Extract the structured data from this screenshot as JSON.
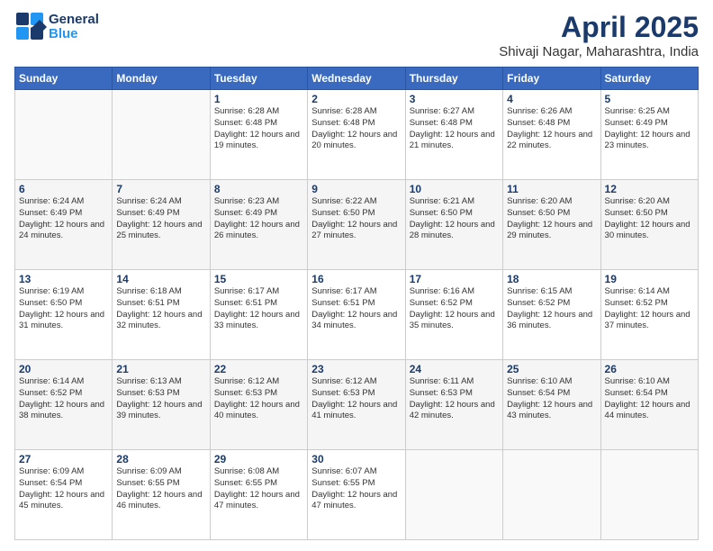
{
  "logo": {
    "line1": "General",
    "line2": "Blue"
  },
  "title": "April 2025",
  "subtitle": "Shivaji Nagar, Maharashtra, India",
  "days": [
    "Sunday",
    "Monday",
    "Tuesday",
    "Wednesday",
    "Thursday",
    "Friday",
    "Saturday"
  ],
  "weeks": [
    [
      {
        "day": "",
        "sunrise": "",
        "sunset": "",
        "daylight": ""
      },
      {
        "day": "",
        "sunrise": "",
        "sunset": "",
        "daylight": ""
      },
      {
        "day": "1",
        "sunrise": "Sunrise: 6:28 AM",
        "sunset": "Sunset: 6:48 PM",
        "daylight": "Daylight: 12 hours and 19 minutes."
      },
      {
        "day": "2",
        "sunrise": "Sunrise: 6:28 AM",
        "sunset": "Sunset: 6:48 PM",
        "daylight": "Daylight: 12 hours and 20 minutes."
      },
      {
        "day": "3",
        "sunrise": "Sunrise: 6:27 AM",
        "sunset": "Sunset: 6:48 PM",
        "daylight": "Daylight: 12 hours and 21 minutes."
      },
      {
        "day": "4",
        "sunrise": "Sunrise: 6:26 AM",
        "sunset": "Sunset: 6:48 PM",
        "daylight": "Daylight: 12 hours and 22 minutes."
      },
      {
        "day": "5",
        "sunrise": "Sunrise: 6:25 AM",
        "sunset": "Sunset: 6:49 PM",
        "daylight": "Daylight: 12 hours and 23 minutes."
      }
    ],
    [
      {
        "day": "6",
        "sunrise": "Sunrise: 6:24 AM",
        "sunset": "Sunset: 6:49 PM",
        "daylight": "Daylight: 12 hours and 24 minutes."
      },
      {
        "day": "7",
        "sunrise": "Sunrise: 6:24 AM",
        "sunset": "Sunset: 6:49 PM",
        "daylight": "Daylight: 12 hours and 25 minutes."
      },
      {
        "day": "8",
        "sunrise": "Sunrise: 6:23 AM",
        "sunset": "Sunset: 6:49 PM",
        "daylight": "Daylight: 12 hours and 26 minutes."
      },
      {
        "day": "9",
        "sunrise": "Sunrise: 6:22 AM",
        "sunset": "Sunset: 6:50 PM",
        "daylight": "Daylight: 12 hours and 27 minutes."
      },
      {
        "day": "10",
        "sunrise": "Sunrise: 6:21 AM",
        "sunset": "Sunset: 6:50 PM",
        "daylight": "Daylight: 12 hours and 28 minutes."
      },
      {
        "day": "11",
        "sunrise": "Sunrise: 6:20 AM",
        "sunset": "Sunset: 6:50 PM",
        "daylight": "Daylight: 12 hours and 29 minutes."
      },
      {
        "day": "12",
        "sunrise": "Sunrise: 6:20 AM",
        "sunset": "Sunset: 6:50 PM",
        "daylight": "Daylight: 12 hours and 30 minutes."
      }
    ],
    [
      {
        "day": "13",
        "sunrise": "Sunrise: 6:19 AM",
        "sunset": "Sunset: 6:50 PM",
        "daylight": "Daylight: 12 hours and 31 minutes."
      },
      {
        "day": "14",
        "sunrise": "Sunrise: 6:18 AM",
        "sunset": "Sunset: 6:51 PM",
        "daylight": "Daylight: 12 hours and 32 minutes."
      },
      {
        "day": "15",
        "sunrise": "Sunrise: 6:17 AM",
        "sunset": "Sunset: 6:51 PM",
        "daylight": "Daylight: 12 hours and 33 minutes."
      },
      {
        "day": "16",
        "sunrise": "Sunrise: 6:17 AM",
        "sunset": "Sunset: 6:51 PM",
        "daylight": "Daylight: 12 hours and 34 minutes."
      },
      {
        "day": "17",
        "sunrise": "Sunrise: 6:16 AM",
        "sunset": "Sunset: 6:52 PM",
        "daylight": "Daylight: 12 hours and 35 minutes."
      },
      {
        "day": "18",
        "sunrise": "Sunrise: 6:15 AM",
        "sunset": "Sunset: 6:52 PM",
        "daylight": "Daylight: 12 hours and 36 minutes."
      },
      {
        "day": "19",
        "sunrise": "Sunrise: 6:14 AM",
        "sunset": "Sunset: 6:52 PM",
        "daylight": "Daylight: 12 hours and 37 minutes."
      }
    ],
    [
      {
        "day": "20",
        "sunrise": "Sunrise: 6:14 AM",
        "sunset": "Sunset: 6:52 PM",
        "daylight": "Daylight: 12 hours and 38 minutes."
      },
      {
        "day": "21",
        "sunrise": "Sunrise: 6:13 AM",
        "sunset": "Sunset: 6:53 PM",
        "daylight": "Daylight: 12 hours and 39 minutes."
      },
      {
        "day": "22",
        "sunrise": "Sunrise: 6:12 AM",
        "sunset": "Sunset: 6:53 PM",
        "daylight": "Daylight: 12 hours and 40 minutes."
      },
      {
        "day": "23",
        "sunrise": "Sunrise: 6:12 AM",
        "sunset": "Sunset: 6:53 PM",
        "daylight": "Daylight: 12 hours and 41 minutes."
      },
      {
        "day": "24",
        "sunrise": "Sunrise: 6:11 AM",
        "sunset": "Sunset: 6:53 PM",
        "daylight": "Daylight: 12 hours and 42 minutes."
      },
      {
        "day": "25",
        "sunrise": "Sunrise: 6:10 AM",
        "sunset": "Sunset: 6:54 PM",
        "daylight": "Daylight: 12 hours and 43 minutes."
      },
      {
        "day": "26",
        "sunrise": "Sunrise: 6:10 AM",
        "sunset": "Sunset: 6:54 PM",
        "daylight": "Daylight: 12 hours and 44 minutes."
      }
    ],
    [
      {
        "day": "27",
        "sunrise": "Sunrise: 6:09 AM",
        "sunset": "Sunset: 6:54 PM",
        "daylight": "Daylight: 12 hours and 45 minutes."
      },
      {
        "day": "28",
        "sunrise": "Sunrise: 6:09 AM",
        "sunset": "Sunset: 6:55 PM",
        "daylight": "Daylight: 12 hours and 46 minutes."
      },
      {
        "day": "29",
        "sunrise": "Sunrise: 6:08 AM",
        "sunset": "Sunset: 6:55 PM",
        "daylight": "Daylight: 12 hours and 47 minutes."
      },
      {
        "day": "30",
        "sunrise": "Sunrise: 6:07 AM",
        "sunset": "Sunset: 6:55 PM",
        "daylight": "Daylight: 12 hours and 47 minutes."
      },
      {
        "day": "",
        "sunrise": "",
        "sunset": "",
        "daylight": ""
      },
      {
        "day": "",
        "sunrise": "",
        "sunset": "",
        "daylight": ""
      },
      {
        "day": "",
        "sunrise": "",
        "sunset": "",
        "daylight": ""
      }
    ]
  ]
}
